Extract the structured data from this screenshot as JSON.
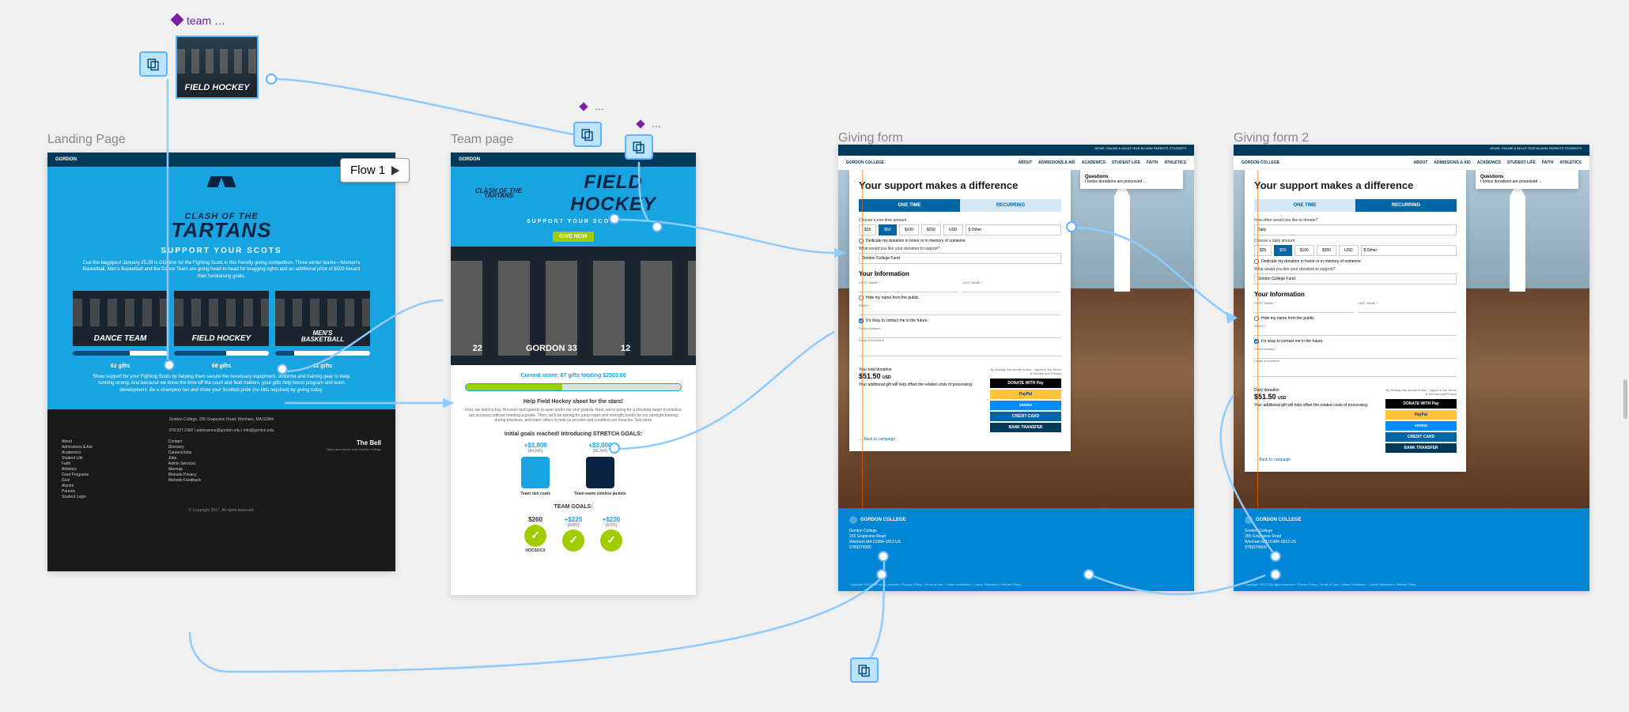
{
  "component": {
    "label": "team …",
    "thumb_text": "FIELD HOCKEY"
  },
  "instance_label": "…",
  "flow_badge": "Flow 1",
  "frames": {
    "landing": {
      "label": "Landing Page"
    },
    "team": {
      "label": "Team page"
    },
    "form1": {
      "label": "Giving form"
    },
    "form2": {
      "label": "Giving form 2"
    }
  },
  "landing": {
    "logo": "GORDON",
    "clash_small": "CLASH OF THE",
    "clash_big": "TARTANS",
    "support": "SUPPORT YOUR SCOTS",
    "intro": "Cue the bagpipes! January 25-29 is GO time for the Fighting Scots in this friendly giving competition. Three winter teams—Women's Basketball, Men's Basketball and the Dance Team are going head-to-head for bragging rights and an additional prize of $500 toward their fundraising goals.",
    "cards": [
      {
        "title": "DANCE TEAM",
        "gifts": "62 gifts",
        "pct": 60
      },
      {
        "title": "FIELD HOCKEY",
        "gifts": "68 gifts",
        "pct": 55
      },
      {
        "title": "MEN'S BASKETBALL",
        "gifts_top": "MEN'S",
        "gifts": "11 gifts",
        "pct": 20
      }
    ],
    "text2": "Show support for your Fighting Scots by helping them secure the necessary equipment, uniforms and training gear to keep running strong. And because we know the time off the court and field matters, your gifts help boost program and team development. Be a champion fan and show your Scottish pride (no kilts required) by giving today.",
    "footer_addr": "Gordon College, 255 Grapevine Road, Wenham, MA 01984",
    "footer_contact": "978.927.2300  |  admissions@gordon.edu  |  info@gordon.edu",
    "footer_cols": [
      [
        "About",
        "Admissions & Aid",
        "Academics",
        "Student Life",
        "Faith",
        "Athletics",
        "Grad Programs",
        "Give",
        "Alumni",
        "Parents",
        "Student Login"
      ],
      [
        "Contact",
        "Directory",
        "Careers/Jobs",
        "Jobs",
        "Admin Services",
        "Sitemap",
        "Website Privacy",
        "Website Feedback"
      ]
    ],
    "bell": "The Bell",
    "bell_sub": "News and stories from Gordon College",
    "copyright": "© Copyright 2017. All rights reserved."
  },
  "team": {
    "logo": "GORDON",
    "clash": "CLASH OF THE TARTANS",
    "title": "FIELD HOCKEY",
    "sub": "SUPPORT YOUR SCOTS",
    "give": "GIVE NOW",
    "jerseys": [
      "22",
      "GORDON 33",
      "12",
      ""
    ],
    "score": "Current score: 67 gifts totaling $2503.00",
    "help_h": "Help Field Hockey shoot for the stars!",
    "help_t": "First, we want to buy Hocsocx rash guards to wear under our shin guards. Next, we're going for a shooting target to practice our accuracy without needing a goalie. Then, we'll be aiming for jump ropes and strength bands for our strength training during practices, and foam rollers to help us recover and condition our muscles. See more",
    "goals_h": "Initial goals reached! Introducing STRETCH GOALS:",
    "goals": [
      {
        "amt": "+$1,800",
        "sub": "($4,600)",
        "label": "Team rain coats"
      },
      {
        "amt": "+$3,000",
        "sub": "($6,300)",
        "label": "Team warm sideline jackets"
      }
    ],
    "team_goals_h": "TEAM GOALS:",
    "team_goals": [
      {
        "amt": "$260",
        "sub": "",
        "label": "HOCSOCX"
      },
      {
        "amt": "+$225",
        "sub": "($485)",
        "label": ""
      },
      {
        "amt": "+$220",
        "sub": "($705)",
        "label": ""
      }
    ]
  },
  "form_shared": {
    "topbar_links": "NEWS, ONLINE & ADULT    GIVE    ALUMNI    PARENTS    STUDENTS",
    "nav": [
      "ABOUT",
      "ADMISSIONS & AID",
      "ACADEMICS",
      "STUDENT LIFE",
      "FAITH",
      "ATHLETICS"
    ],
    "logo": "GORDON COLLEGE",
    "heading": "Your support makes a difference",
    "q_title": "Questions",
    "q_text": "I notice donations are processed …",
    "tabs": [
      "ONE TIME",
      "RECURRING"
    ],
    "designation_q": "What would you like your donation to support?",
    "designation": "Gordon College Fund",
    "dedicate": "Dedicate my donation in honor or in memory of someone",
    "info_h": "Your Information",
    "first": "FIRST NAME *",
    "last": "LAST NAME *",
    "hide": "Hide my name from the public.",
    "email": "EMAIL *",
    "contact_ok": "It's okay to contact me in the future.",
    "phone": "Phone Number",
    "comment": "Leave a comment",
    "total_lbl": "Your total donation",
    "total": "$51.50",
    "currency": "USD",
    "offset": "Your additional gift will help offset the related costs of processing.",
    "terms": "By clicking this donate button, I agree to the Terms of Service and Privacy",
    "btns": {
      "apple": "DONATE WITH  Pay",
      "paypal": "PayPal",
      "venmo": "venmo",
      "cc": "CREDIT CARD",
      "bank": "BANK TRANSFER"
    },
    "back": "← Back to campaign",
    "footer_name": "GORDON COLLEGE",
    "footer_addr": [
      "Gordon College",
      "255 Grapevine Road",
      "Wenham MA 01984-1813 US",
      "9789274500"
    ],
    "footer_legal": "Copyright ©2021 All rights reserved • Privacy Policy • Terms of Use • Visitor Guidelines • Cookie Statement • Refund Policy"
  },
  "form1": {
    "active_tab": 0,
    "amount_label": "Choose a one-time amount",
    "amounts": [
      "$25",
      "$50",
      "$100",
      "$250"
    ],
    "selected": 1,
    "currency_sel": "USD",
    "other": "$ Other"
  },
  "form2": {
    "active_tab": 1,
    "freq_label": "How often would you like to donate?",
    "freq_value": "Daily",
    "amount_label": "Choose a daily amount",
    "amounts": [
      "$25",
      "$50",
      "$100",
      "$250"
    ],
    "selected": 1,
    "currency_sel": "USD",
    "other": "$ Other",
    "total_lbl_override": "Daily donation"
  }
}
